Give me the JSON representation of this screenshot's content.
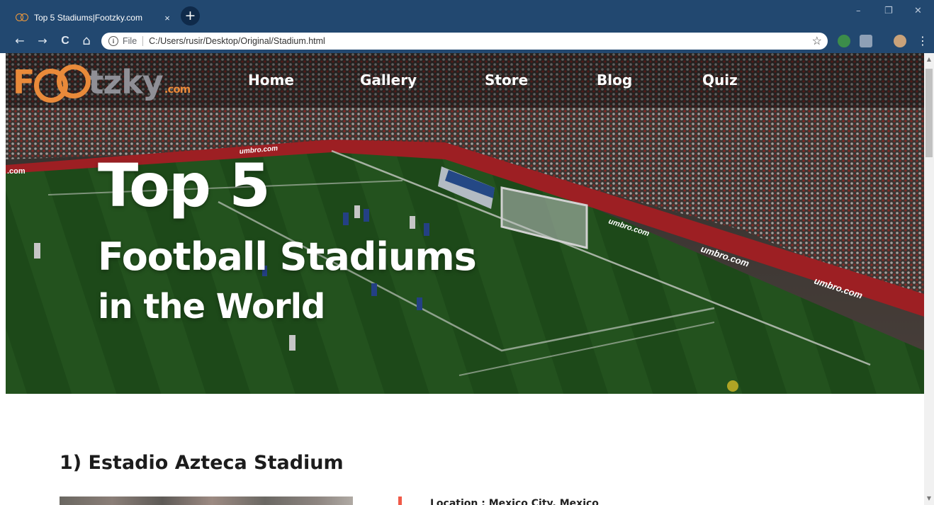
{
  "browser": {
    "tab_title": "Top 5 Stadiums|Footzky.com",
    "tab_close": "×",
    "new_tab": "+",
    "window_controls": {
      "minimize": "–",
      "restore": "❐",
      "close": "✕"
    },
    "nav": {
      "back": "←",
      "forward": "→",
      "reload": "C",
      "home": "⌂"
    },
    "address": {
      "info": "i",
      "scheme": "File",
      "url": "C:/Users/rusir/Desktop/Original/Stadium.html",
      "bookmark": "☆"
    },
    "menu": "⋮",
    "icons": [
      "stadium-favicon",
      "info-icon",
      "star-icon",
      "extension-icon",
      "pdf-icon",
      "profile-icon",
      "menu-icon"
    ]
  },
  "site": {
    "logo": {
      "f": "F",
      "word": "tzky",
      "dotcom": ".com"
    },
    "nav": [
      "Home",
      "Gallery",
      "Store",
      "Blog",
      "Quiz"
    ]
  },
  "hero": {
    "line1": "Top 5",
    "line2": "Football Stadiums",
    "line3": "in the World",
    "ad_boards": [
      "umbro.com",
      "umbro.com",
      "umbro.com",
      "umbro.com",
      ".com"
    ]
  },
  "content": {
    "heading": "1) Estadio Azteca Stadium",
    "location": "Location : Mexico City, Mexico"
  },
  "colors": {
    "chrome": "#224870",
    "logo_orange": "#e98a3a",
    "accent": "#f05a48"
  }
}
